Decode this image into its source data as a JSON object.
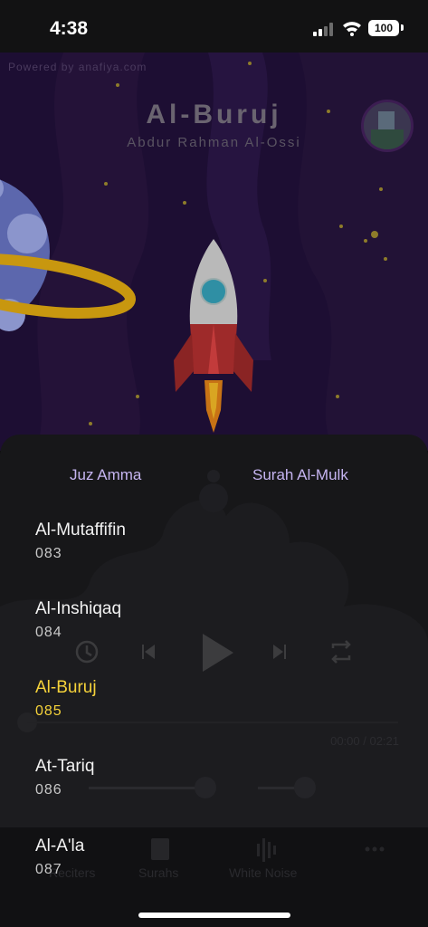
{
  "status": {
    "time": "4:38",
    "battery": "100"
  },
  "player": {
    "powered_by": "Powered by anafiya.com",
    "title": "Al-Buruj",
    "artist": "Abdur Rahman Al-Ossi",
    "time_display": "00:00 / 02:21"
  },
  "tabs": [
    {
      "label": "Juz Amma"
    },
    {
      "label": "Surah Al-Mulk"
    }
  ],
  "surahs": [
    {
      "name": "Al-Mutaffifin",
      "number": "083",
      "active": false
    },
    {
      "name": "Al-Inshiqaq",
      "number": "084",
      "active": false
    },
    {
      "name": "Al-Buruj",
      "number": "085",
      "active": true
    },
    {
      "name": "At-Tariq",
      "number": "086",
      "active": false
    },
    {
      "name": "Al-A'la",
      "number": "087",
      "active": false
    }
  ],
  "bottom_nav": [
    {
      "label": "Reciters"
    },
    {
      "label": "Surahs"
    },
    {
      "label": "White Noise"
    }
  ],
  "colors": {
    "accent": "#f5d23a",
    "tab_text": "#c5b4f0",
    "scene_bg": "#1d0e33"
  }
}
